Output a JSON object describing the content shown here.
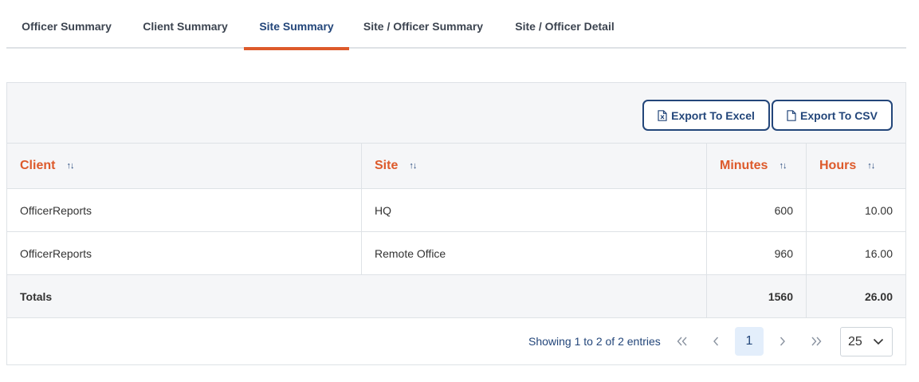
{
  "tabs": [
    {
      "label": "Officer Summary"
    },
    {
      "label": "Client Summary"
    },
    {
      "label": "Site Summary"
    },
    {
      "label": "Site / Officer Summary"
    },
    {
      "label": "Site / Officer Detail"
    }
  ],
  "active_tab": "Site Summary",
  "toolbar": {
    "export_excel_label": "Export To Excel",
    "export_csv_label": "Export To CSV"
  },
  "table": {
    "headers": [
      "Client",
      "Site",
      "Minutes",
      "Hours"
    ],
    "rows": [
      {
        "client": "OfficerReports",
        "site": "HQ",
        "minutes": "600",
        "hours": "10.00"
      },
      {
        "client": "OfficerReports",
        "site": "Remote Office",
        "minutes": "960",
        "hours": "16.00"
      }
    ],
    "totals": {
      "label": "Totals",
      "minutes": "1560",
      "hours": "26.00"
    }
  },
  "pagination": {
    "info": "Showing 1 to 2 of 2 entries",
    "current_page": "1",
    "page_size": "25"
  },
  "colors": {
    "accent": "#dd5a2b",
    "primary": "#23467a"
  }
}
